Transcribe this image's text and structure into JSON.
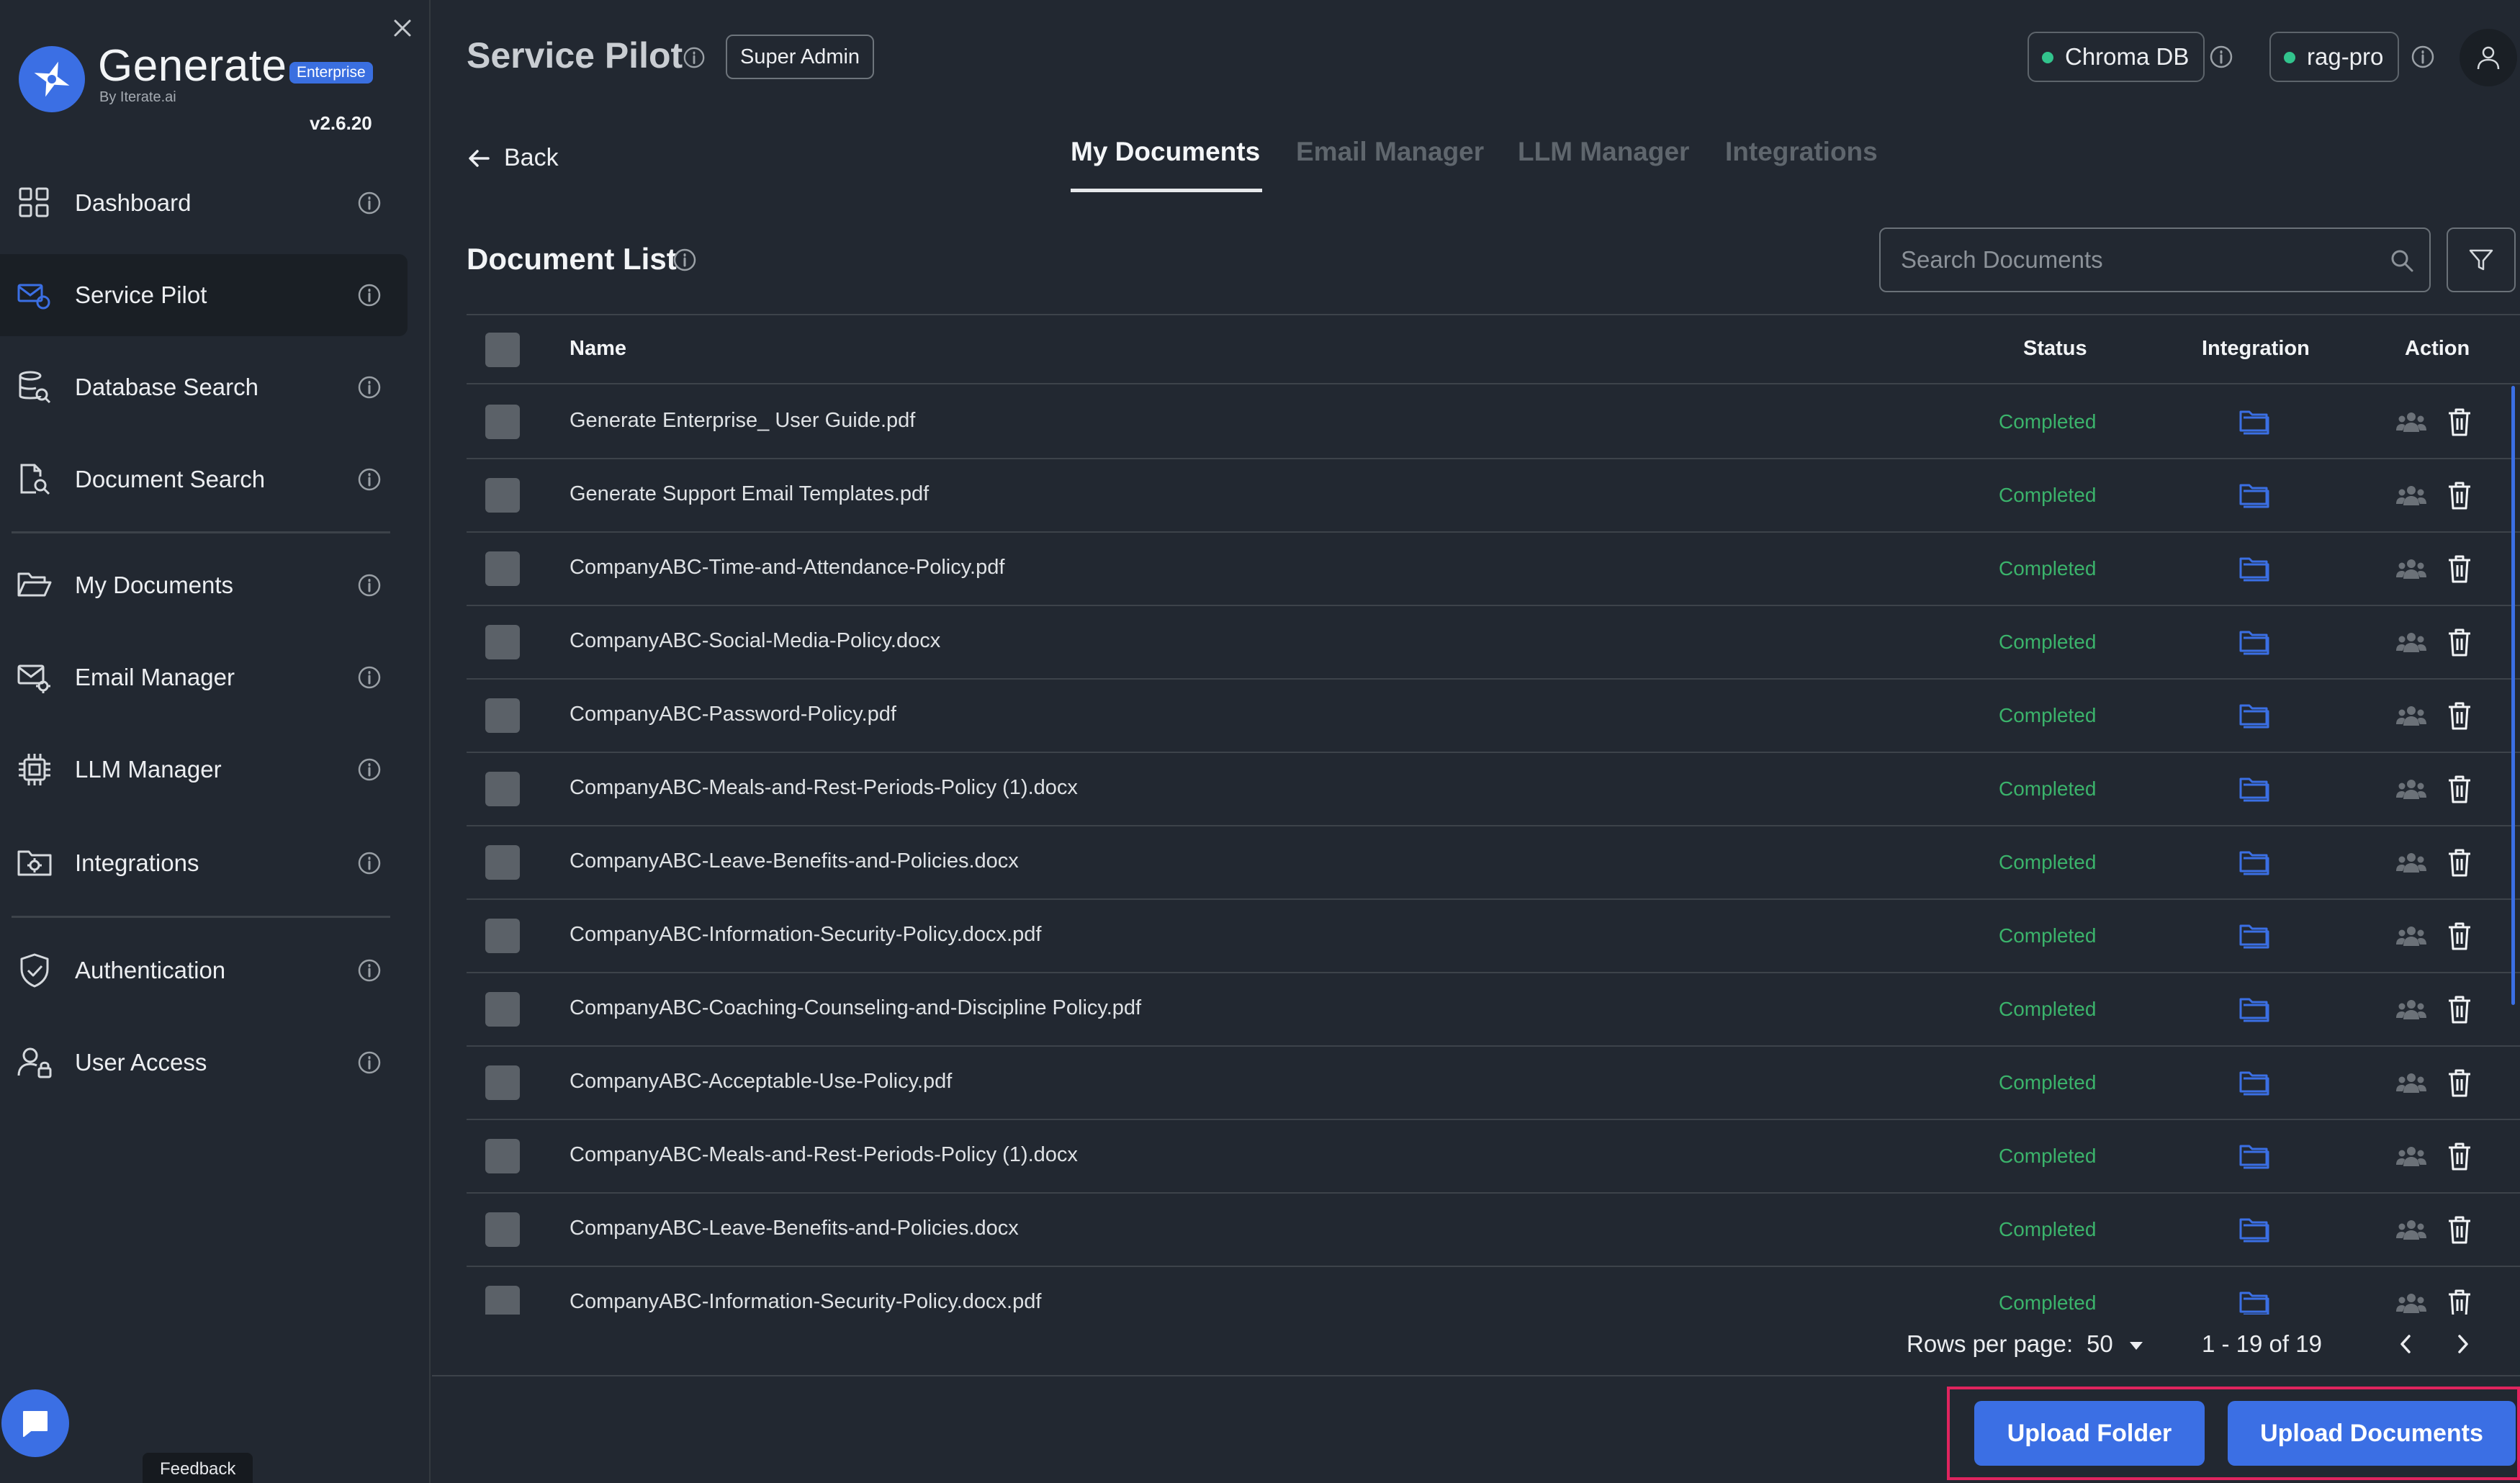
{
  "sidebar": {
    "brand": "Generate",
    "badge": "Enterprise",
    "subtitle": "By Iterate.ai",
    "version": "v2.6.20",
    "items": [
      {
        "label": "Dashboard",
        "icon": "dashboard-grid-icon"
      },
      {
        "label": "Service Pilot",
        "icon": "service-pilot-icon",
        "active": true
      },
      {
        "label": "Database Search",
        "icon": "database-search-icon"
      },
      {
        "label": "Document Search",
        "icon": "document-search-icon"
      },
      {
        "label": "My Documents",
        "icon": "folder-open-icon"
      },
      {
        "label": "Email Manager",
        "icon": "email-gear-icon"
      },
      {
        "label": "LLM Manager",
        "icon": "chip-icon"
      },
      {
        "label": "Integrations",
        "icon": "folder-gear-icon"
      },
      {
        "label": "Authentication",
        "icon": "shield-check-icon"
      },
      {
        "label": "User Access",
        "icon": "user-lock-icon"
      }
    ],
    "feedback": "Feedback"
  },
  "header": {
    "title": "Service Pilot",
    "role": "Super Admin",
    "vector_db": "Chroma DB",
    "model": "rag-pro"
  },
  "nav": {
    "back": "Back",
    "tabs": [
      "My Documents",
      "Email Manager",
      "LLM Manager",
      "Integrations"
    ],
    "active_tab": "My Documents"
  },
  "list": {
    "title": "Document List",
    "search_placeholder": "Search Documents",
    "columns": [
      "Name",
      "Status",
      "Integration",
      "Action"
    ],
    "rows": [
      {
        "name": "Generate Enterprise_ User Guide.pdf",
        "status": "Completed"
      },
      {
        "name": "Generate Support Email Templates.pdf",
        "status": "Completed"
      },
      {
        "name": "CompanyABC-Time-and-Attendance-Policy.pdf",
        "status": "Completed"
      },
      {
        "name": "CompanyABC-Social-Media-Policy.docx",
        "status": "Completed"
      },
      {
        "name": "CompanyABC-Password-Policy.pdf",
        "status": "Completed"
      },
      {
        "name": "CompanyABC-Meals-and-Rest-Periods-Policy (1).docx",
        "status": "Completed"
      },
      {
        "name": "CompanyABC-Leave-Benefits-and-Policies.docx",
        "status": "Completed"
      },
      {
        "name": "CompanyABC-Information-Security-Policy.docx.pdf",
        "status": "Completed"
      },
      {
        "name": "CompanyABC-Coaching-Counseling-and-Discipline Policy.pdf",
        "status": "Completed"
      },
      {
        "name": "CompanyABC-Acceptable-Use-Policy.pdf",
        "status": "Completed"
      },
      {
        "name": "CompanyABC-Meals-and-Rest-Periods-Policy (1).docx",
        "status": "Completed"
      },
      {
        "name": "CompanyABC-Leave-Benefits-and-Policies.docx",
        "status": "Completed"
      },
      {
        "name": "CompanyABC-Information-Security-Policy.docx.pdf",
        "status": "Completed"
      }
    ]
  },
  "pagination": {
    "rows_per_page_label": "Rows per page:",
    "rows_per_page": "50",
    "range": "1 - 19 of 19"
  },
  "actions": {
    "upload_folder": "Upload Folder",
    "upload_documents": "Upload Documents"
  },
  "colors": {
    "accent": "#3b6fe4",
    "status_completed": "#3bb36b",
    "background": "#222831",
    "highlight": "#e0245e"
  }
}
